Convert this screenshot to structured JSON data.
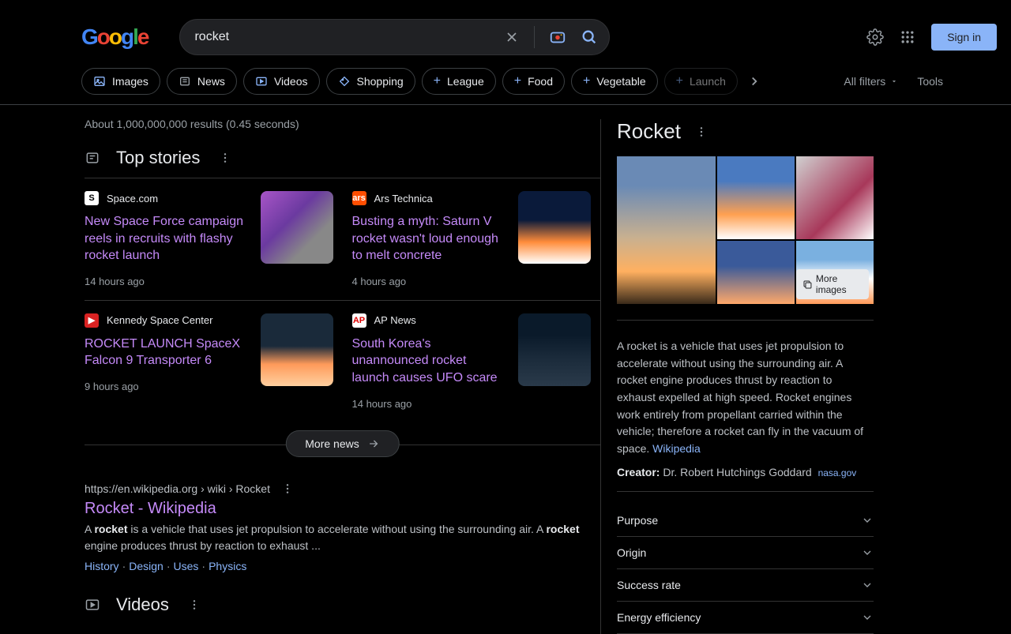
{
  "search": {
    "query": "rocket"
  },
  "header": {
    "signin": "Sign in"
  },
  "filters": {
    "chips": [
      "Images",
      "News",
      "Videos",
      "Shopping",
      "League",
      "Food",
      "Vegetable",
      "Launch"
    ],
    "all_filters": "All filters",
    "tools": "Tools"
  },
  "stats": "About 1,000,000,000 results (0.45 seconds)",
  "top_stories": {
    "title": "Top stories",
    "more": "More news",
    "items": [
      {
        "source": "Space.com",
        "title": "New Space Force campaign reels in recruits with flashy rocket launch",
        "time": "14 hours ago",
        "fav_bg": "#fff",
        "fav_fg": "#000",
        "fav": "S",
        "thumb": "linear-gradient(135deg,#a855c7,#6b3aa0 40%,#888 70%)"
      },
      {
        "source": "Ars Technica",
        "title": "Busting a myth: Saturn V rocket wasn't loud enough to melt concrete",
        "time": "4 hours ago",
        "fav_bg": "#ff4e00",
        "fav_fg": "#fff",
        "fav": "ars",
        "thumb": "linear-gradient(180deg,#0a1a3a 40%,#ff8c3a 70%,#fff 100%)"
      },
      {
        "source": "Kennedy Space Center",
        "title": "ROCKET LAUNCH SpaceX Falcon 9 Transporter 6",
        "time": "9 hours ago",
        "fav_bg": "#d92222",
        "fav_fg": "#fff",
        "fav": "▶",
        "thumb": "linear-gradient(180deg,#1a2a3a 45%,#ff9a5a 70%,#ffd0a0 100%)"
      },
      {
        "source": "AP News",
        "title": "South Korea's unannounced rocket launch causes UFO scare",
        "time": "14 hours ago",
        "fav_bg": "#fff",
        "fav_fg": "#d00",
        "fav": "AP",
        "thumb": "linear-gradient(180deg,#0a1a2a 30%,#1a2a3a 60%,#2a3a4a 100%)"
      }
    ]
  },
  "wiki_result": {
    "url": "https://en.wikipedia.org › wiki › Rocket",
    "title": "Rocket - Wikipedia",
    "snippet_pre": "A ",
    "snippet_bold1": "rocket",
    "snippet_mid": " is a vehicle that uses jet propulsion to accelerate without using the surrounding air. A ",
    "snippet_bold2": "rocket",
    "snippet_post": " engine produces thrust by reaction to exhaust ...",
    "links": [
      "History",
      "Design",
      "Uses",
      "Physics"
    ]
  },
  "videos_section": {
    "title": "Videos"
  },
  "kp": {
    "title": "Rocket",
    "more_images": "More images",
    "desc": "A rocket is a vehicle that uses jet propulsion to accelerate without using the surrounding air. A rocket engine produces thrust by reaction to exhaust expelled at high speed. Rocket engines work entirely from propellant carried within the vehicle; therefore a rocket can fly in the vacuum of space. ",
    "desc_link": "Wikipedia",
    "creator_label": "Creator:",
    "creator_value": "Dr. Robert Hutchings Goddard",
    "creator_src": "nasa.gov",
    "accordion": [
      "Purpose",
      "Origin",
      "Success rate",
      "Energy efficiency"
    ]
  }
}
